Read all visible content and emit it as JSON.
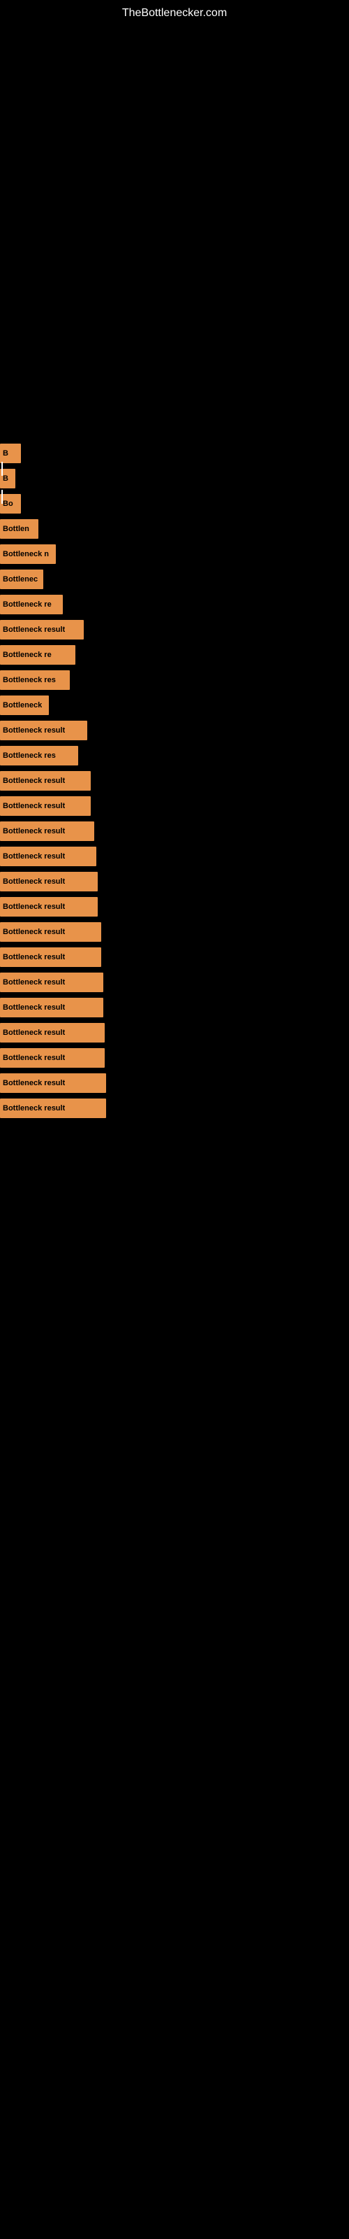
{
  "site": {
    "title": "TheBottlenecker.com"
  },
  "bars": [
    {
      "id": 1,
      "label": "B",
      "width_class": "bar-1"
    },
    {
      "id": 2,
      "label": "B",
      "width_class": "bar-2"
    },
    {
      "id": 3,
      "label": "Bo",
      "width_class": "bar-3"
    },
    {
      "id": 4,
      "label": "Bottlen",
      "width_class": "bar-4"
    },
    {
      "id": 5,
      "label": "Bottleneck n",
      "width_class": "bar-5"
    },
    {
      "id": 6,
      "label": "Bottlenec",
      "width_class": "bar-6"
    },
    {
      "id": 7,
      "label": "Bottleneck re",
      "width_class": "bar-7"
    },
    {
      "id": 8,
      "label": "Bottleneck result",
      "width_class": "bar-8"
    },
    {
      "id": 9,
      "label": "Bottleneck re",
      "width_class": "bar-9"
    },
    {
      "id": 10,
      "label": "Bottleneck res",
      "width_class": "bar-10"
    },
    {
      "id": 11,
      "label": "Bottleneck",
      "width_class": "bar-11"
    },
    {
      "id": 12,
      "label": "Bottleneck result",
      "width_class": "bar-12"
    },
    {
      "id": 13,
      "label": "Bottleneck res",
      "width_class": "bar-13"
    },
    {
      "id": 14,
      "label": "Bottleneck result",
      "width_class": "bar-14"
    },
    {
      "id": 15,
      "label": "Bottleneck result",
      "width_class": "bar-15"
    },
    {
      "id": 16,
      "label": "Bottleneck result",
      "width_class": "bar-16"
    },
    {
      "id": 17,
      "label": "Bottleneck result",
      "width_class": "bar-17"
    },
    {
      "id": 18,
      "label": "Bottleneck result",
      "width_class": "bar-18"
    },
    {
      "id": 19,
      "label": "Bottleneck result",
      "width_class": "bar-19"
    },
    {
      "id": 20,
      "label": "Bottleneck result",
      "width_class": "bar-20"
    },
    {
      "id": 21,
      "label": "Bottleneck result",
      "width_class": "bar-21"
    },
    {
      "id": 22,
      "label": "Bottleneck result",
      "width_class": "bar-22"
    },
    {
      "id": 23,
      "label": "Bottleneck result",
      "width_class": "bar-23"
    },
    {
      "id": 24,
      "label": "Bottleneck result",
      "width_class": "bar-24"
    },
    {
      "id": 25,
      "label": "Bottleneck result",
      "width_class": "bar-25"
    },
    {
      "id": 26,
      "label": "Bottleneck result",
      "width_class": "bar-26"
    },
    {
      "id": 27,
      "label": "Bottleneck result",
      "width_class": "bar-27"
    }
  ],
  "colors": {
    "background": "#000000",
    "bar_fill": "#e8934a",
    "bar_text": "#000000",
    "site_title": "#ffffff"
  }
}
